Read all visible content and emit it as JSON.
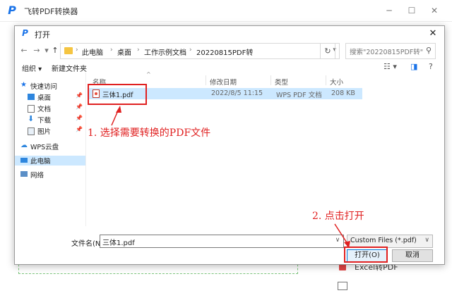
{
  "app": {
    "title": "飞转PDF转换器",
    "logo_letter": "P",
    "minimize_glyph": "─",
    "maximize_glyph": "☐",
    "close_glyph": "✕",
    "bg_list_item": "Excel转PDF"
  },
  "dialog": {
    "title": "打开",
    "icon_letter": "P",
    "close_glyph": "✕",
    "nav": {
      "back": "←",
      "forward": "→",
      "recent": "▾",
      "up": "↑"
    },
    "breadcrumb": [
      "此电脑",
      "桌面",
      "工作示例文档",
      "20220815PDF转"
    ],
    "breadcrumb_sep": "›",
    "refresh_glyph": "↻",
    "search_placeholder": "搜索\"20220815PDF转\"",
    "search_glyph": "⚲",
    "toolbar": {
      "organize": "组织 ▾",
      "new_folder": "新建文件夹",
      "view_glyph": "☷ ▾",
      "pane_glyph": "◨",
      "help_glyph": "?"
    },
    "nav_pane": [
      {
        "label": "快速访问",
        "pinned": false
      },
      {
        "label": "桌面",
        "pinned": true
      },
      {
        "label": "文档",
        "pinned": true
      },
      {
        "label": "下载",
        "pinned": true
      },
      {
        "label": "图片",
        "pinned": true
      },
      {
        "label": "WPS云盘",
        "pinned": false
      },
      {
        "label": "此电脑",
        "pinned": false
      },
      {
        "label": "网络",
        "pinned": false
      }
    ],
    "pin_glyph": "📌",
    "columns": [
      "名称",
      "修改日期",
      "类型",
      "大小"
    ],
    "sort_glyph": "^",
    "files": [
      {
        "name": "三体1.pdf",
        "modified": "2022/8/5 11:15",
        "type": "WPS PDF 文档",
        "size": "208 KB"
      }
    ],
    "filename_label": "文件名(N):",
    "filename_value": "三体1.pdf",
    "filename_dd": "∨",
    "filter_value": "Custom Files (*.pdf)",
    "filter_dd": "∨",
    "open_button": "打开(O)",
    "cancel_button": "取消"
  },
  "annotations": {
    "step1": "1. 选择需要转换的PDF文件",
    "step2": "2. 点击打开"
  },
  "colors": {
    "accent": "#1a73e8",
    "selection": "#cce8ff",
    "annotation_red": "#e02020",
    "folder": "#f5c542"
  }
}
